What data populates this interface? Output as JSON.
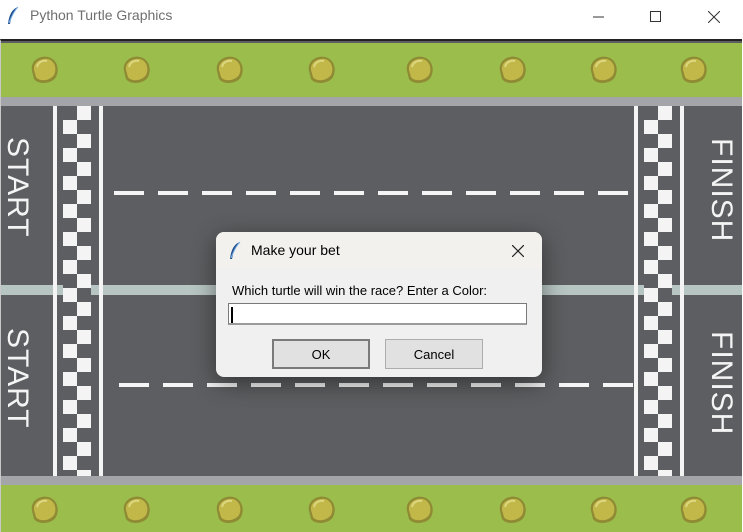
{
  "window": {
    "title": "Python Turtle Graphics",
    "icon": "feather-icon",
    "controls": [
      "minimize",
      "maximize",
      "close"
    ]
  },
  "track": {
    "lanes": [
      {
        "start_label": "START",
        "finish_label": "FINISH"
      },
      {
        "start_label": "START",
        "finish_label": "FINISH"
      }
    ],
    "colors": {
      "grass": "#9bbd4c",
      "asphalt": "#5d5e61",
      "curb": "#a4a5a8",
      "lane_divider": "#b8c6c3",
      "rock": "#c2b84a"
    }
  },
  "dialog": {
    "title": "Make your bet",
    "prompt": "Which turtle will win the race? Enter a Color:",
    "input_value": "",
    "ok_label": "OK",
    "cancel_label": "Cancel"
  }
}
